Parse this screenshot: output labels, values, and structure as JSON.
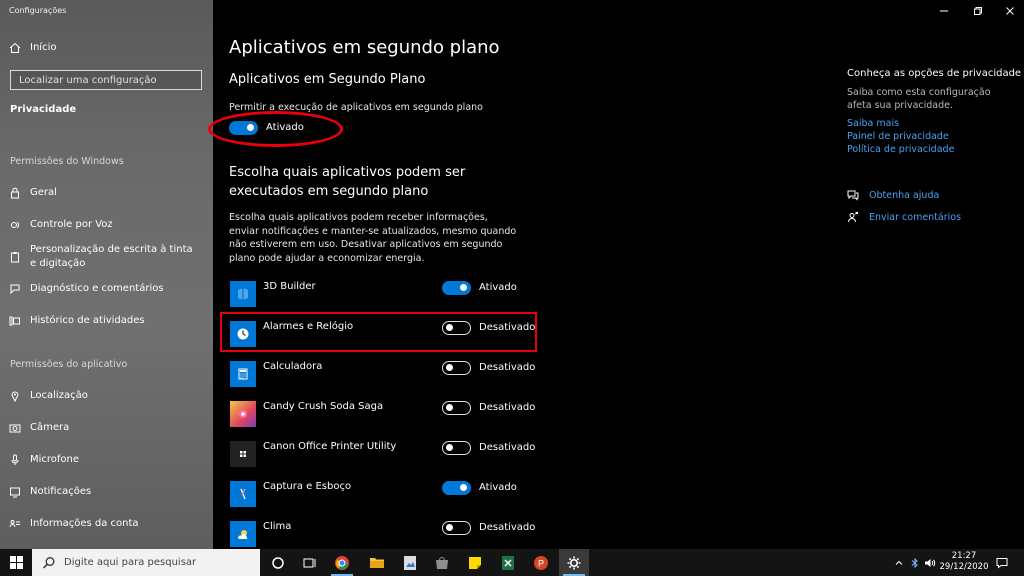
{
  "window": {
    "title": "Configurações"
  },
  "sidebar": {
    "home": "Início",
    "search_placeholder": "Localizar uma configuração",
    "category": "Privacidade",
    "section_windows": "Permissões do Windows",
    "windows_items": [
      {
        "label": "Geral",
        "icon": "lock-icon"
      },
      {
        "label": "Controle por Voz",
        "icon": "voice-icon"
      },
      {
        "label": "Personalização de escrita à tinta e digitação",
        "icon": "clipboard-icon"
      },
      {
        "label": "Diagnóstico e comentários",
        "icon": "feedback-icon"
      },
      {
        "label": "Histórico de atividades",
        "icon": "timeline-icon"
      }
    ],
    "section_app": "Permissões do aplicativo",
    "app_items": [
      {
        "label": "Localização",
        "icon": "location-icon"
      },
      {
        "label": "Câmera",
        "icon": "camera-icon"
      },
      {
        "label": "Microfone",
        "icon": "microphone-icon"
      },
      {
        "label": "Notificações",
        "icon": "notification-icon"
      },
      {
        "label": "Informações da conta",
        "icon": "account-info-icon"
      }
    ]
  },
  "main": {
    "title": "Aplicativos em segundo plano",
    "subtitle": "Aplicativos em Segundo Plano",
    "allow_label": "Permitir a execução de aplicativos em segundo plano",
    "allow_state": "Ativado",
    "choose_heading": "Escolha quais aplicativos podem ser executados em segundo plano",
    "choose_desc": "Escolha quais aplicativos podem receber informações, enviar notificações e manter-se atualizados, mesmo quando não estiverem em uso. Desativar aplicativos em segundo plano pode ajudar a economizar energia.",
    "apps": [
      {
        "name": "3D Builder",
        "on": true,
        "state": "Ativado",
        "icon_color": "#0078d7"
      },
      {
        "name": "Alarmes e Relógio",
        "on": false,
        "state": "Desativado",
        "icon_color": "#0078d7"
      },
      {
        "name": "Calculadora",
        "on": false,
        "state": "Desativado",
        "icon_color": "#0078d7"
      },
      {
        "name": "Candy Crush Soda Saga",
        "on": false,
        "state": "Desativado",
        "icon_color": "#e9a22b"
      },
      {
        "name": "Canon Office Printer Utility",
        "on": false,
        "state": "Desativado",
        "icon_color": "#222222"
      },
      {
        "name": "Captura e Esboço",
        "on": true,
        "state": "Ativado",
        "icon_color": "#0078d7"
      },
      {
        "name": "Clima",
        "on": false,
        "state": "Desativado",
        "icon_color": "#0078d7"
      }
    ]
  },
  "right": {
    "title": "Conheça as opções de privacidade",
    "desc": "Saiba como esta configuração afeta sua privacidade.",
    "links": [
      "Saiba mais",
      "Painel de privacidade",
      "Política de privacidade"
    ],
    "help": "Obtenha ajuda",
    "feedback": "Enviar comentários"
  },
  "taskbar": {
    "search_placeholder": "Digite aqui para pesquisar",
    "time": "21:27",
    "date": "29/12/2020"
  },
  "colors": {
    "accent": "#0078d7",
    "annotation": "#e8000b",
    "link": "#4aa0f0"
  }
}
